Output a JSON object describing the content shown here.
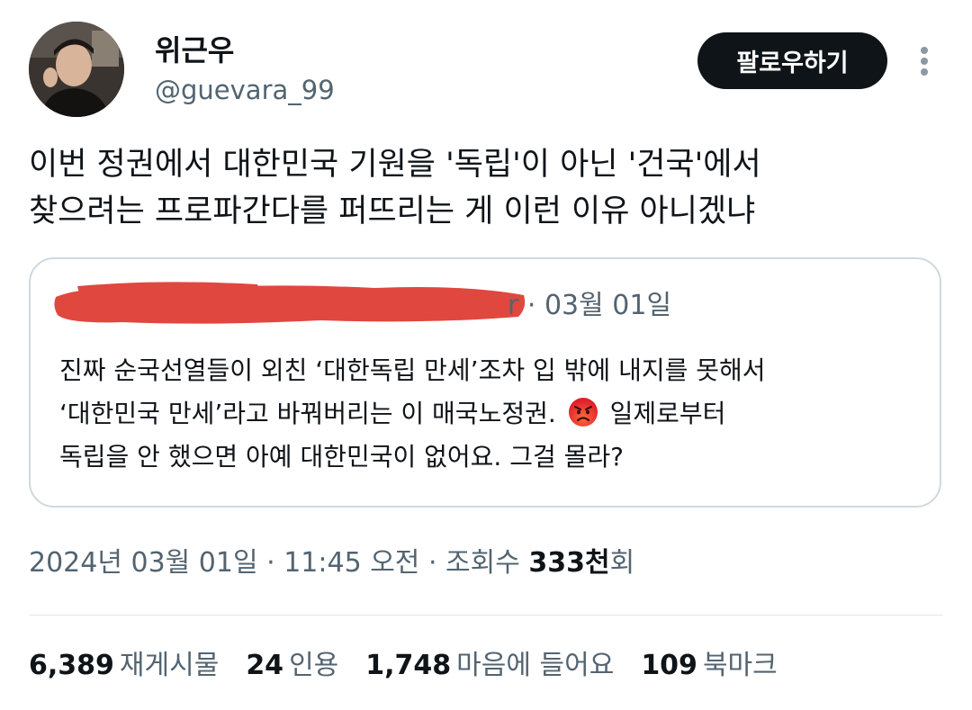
{
  "author": {
    "display_name": "위근우",
    "handle": "@guevara_99"
  },
  "follow_button_label": "팔로우하기",
  "more_icon": "more-vertical-icon",
  "tweet": {
    "lines": [
      "이번 정권에서 대한민국 기원을 '독립'이 아닌 '건국'에서",
      "찾으려는 프로파간다를 퍼뜨리는 게 이런 이유 아니겠냐"
    ]
  },
  "quote": {
    "author_suffix": "r",
    "date": "03월 01일",
    "lines": [
      "진짜 순국선열들이 외친 ‘대한독립 만세’조차 입 밖에 내지를 못해서",
      "‘대한민국 만세’라고 바꿔버리는 이 매국노정권.",
      "일제로부터",
      "독립을 안 했으면 아예 대한민국이 없어요. 그걸 몰라?"
    ],
    "emoji": "angry-face-emoji"
  },
  "meta": {
    "date": "2024년 03월 01일",
    "time": "11:45 오전",
    "views_prefix": "조회수",
    "views_count": "333천",
    "views_suffix": "회"
  },
  "stats": {
    "reposts": {
      "count": "6,389",
      "label": "재게시물"
    },
    "quotes": {
      "count": "24",
      "label": "인용"
    },
    "likes": {
      "count": "1,748",
      "label": "마음에 들어요"
    },
    "bookmarks": {
      "count": "109",
      "label": "북마크"
    }
  },
  "colors": {
    "text_primary": "#0f1419",
    "text_secondary": "#536471",
    "border": "#cfd9de",
    "redaction": "#e0473f",
    "button_bg": "#0f1419"
  }
}
